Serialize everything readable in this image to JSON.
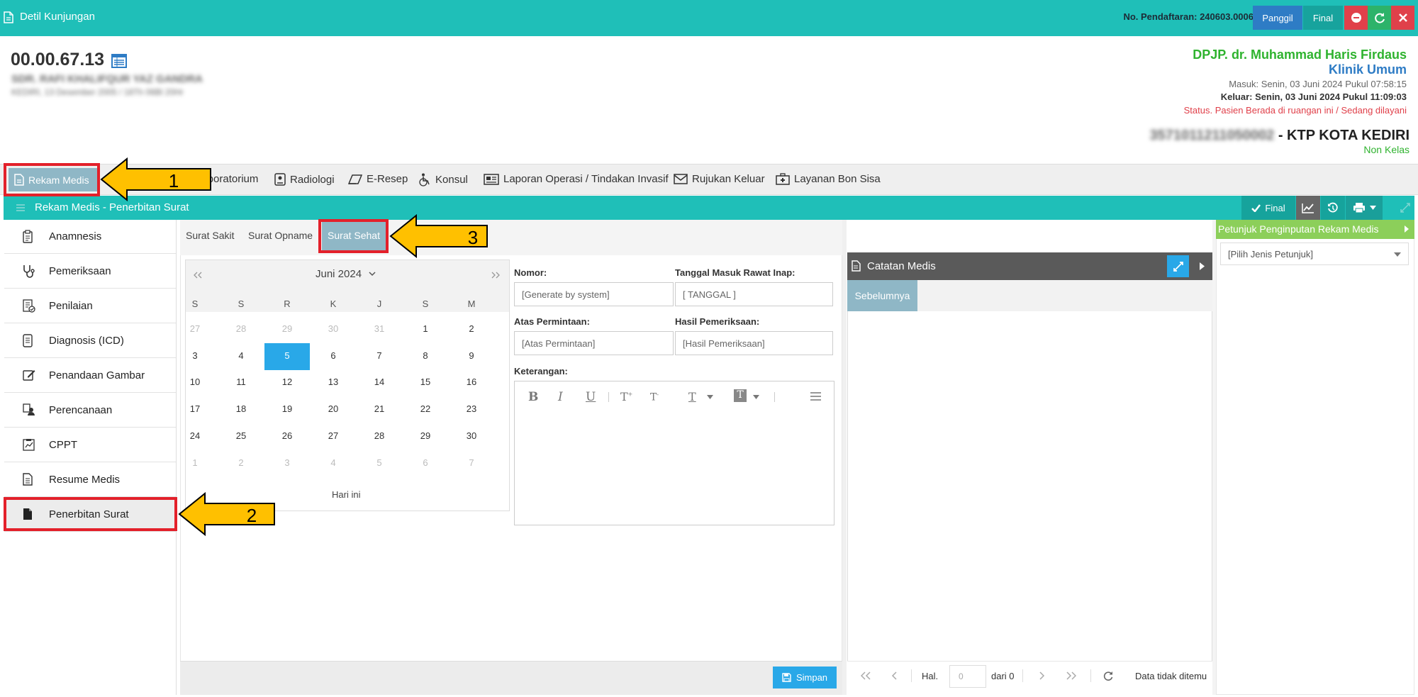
{
  "topbar": {
    "title": "Detil Kunjungan",
    "registration": "No. Pendaftaran: 240603.0006",
    "btn_call": "Panggil",
    "btn_final": "Final"
  },
  "patient": {
    "id": "00.00.67.13",
    "name_blurred": "SDR. RAFI KHALIFQUR YAZ GANDRA",
    "dob_blurred": "KEDIRI, 13 Desember 2005 / 18Th 06Bl 20Hr",
    "doctor": "DPJP. dr. Muhammad Haris Firdaus",
    "clinic": "Klinik Umum",
    "masuk": "Masuk: Senin, 03 Juni 2024 Pukul 07:58:15",
    "keluar": "Keluar: Senin, 03 Juni 2024 Pukul 11:09:03",
    "status": "Status. Pasien Berada di ruangan ini / Sedang dilayani",
    "nik_blurred": "3571011211050002",
    "ktp": "- KTP KOTA KEDIRI",
    "kelas": "Non Kelas"
  },
  "colors": {
    "teal": "#1fbfb8",
    "green": "#2fb32f",
    "blue": "#2e7cc5",
    "red": "#e0404a",
    "selected": "#29a8e8",
    "highlight": "#e3202a",
    "arrow": "#ffc000"
  },
  "nav": {
    "items": [
      "Rekam Medis",
      "Laboratorium",
      "Radiologi",
      "E-Resep",
      "Konsul",
      "Laporan Operasi / Tindakan Invasif",
      "Rujukan Keluar",
      "Layanan Bon Sisa"
    ]
  },
  "section": {
    "title": "Rekam Medis - Penerbitan Surat",
    "final": "Final"
  },
  "menu": {
    "items": [
      "Anamnesis",
      "Pemeriksaan",
      "Penilaian",
      "Diagnosis (ICD)",
      "Penandaan Gambar",
      "Perencanaan",
      "CPPT",
      "Resume Medis",
      "Penerbitan Surat"
    ]
  },
  "tabs": [
    "Surat Sakit",
    "Surat Opname",
    "Surat Sehat"
  ],
  "calendar": {
    "month": "Juni 2024",
    "weekdays": [
      "S",
      "S",
      "R",
      "K",
      "J",
      "S",
      "M"
    ],
    "weeks": [
      [
        "27",
        "28",
        "29",
        "30",
        "31",
        "1",
        "2"
      ],
      [
        "3",
        "4",
        "5",
        "6",
        "7",
        "8",
        "9"
      ],
      [
        "10",
        "11",
        "12",
        "13",
        "14",
        "15",
        "16"
      ],
      [
        "17",
        "18",
        "19",
        "20",
        "21",
        "22",
        "23"
      ],
      [
        "24",
        "25",
        "26",
        "27",
        "28",
        "29",
        "30"
      ],
      [
        "1",
        "2",
        "3",
        "4",
        "5",
        "6",
        "7"
      ]
    ],
    "selected": "5",
    "today_label": "Hari ini"
  },
  "form": {
    "nomor_label": "Nomor:",
    "nomor_placeholder": "[Generate by system]",
    "tanggal_label": "Tanggal Masuk Rawat Inap:",
    "tanggal_placeholder": "[ TANGGAL ]",
    "permintaan_label": "Atas Permintaan:",
    "permintaan_placeholder": "[Atas Permintaan]",
    "hasil_label": "Hasil Pemeriksaan:",
    "hasil_placeholder": "[Hasil Pemeriksaan]",
    "keterangan_label": "Keterangan:",
    "simpan": "Simpan"
  },
  "catatan": {
    "title": "Catatan Medis",
    "tab": "Sebelumnya",
    "hal": "Hal.",
    "page_value": "0",
    "dari": "dari 0",
    "no_data": "Data tidak ditemu"
  },
  "petunjuk": {
    "title": "Petunjuk Penginputan Rekam Medis",
    "select": "[Pilih Jenis Petunjuk]"
  },
  "annotations": [
    "1",
    "2",
    "3"
  ]
}
